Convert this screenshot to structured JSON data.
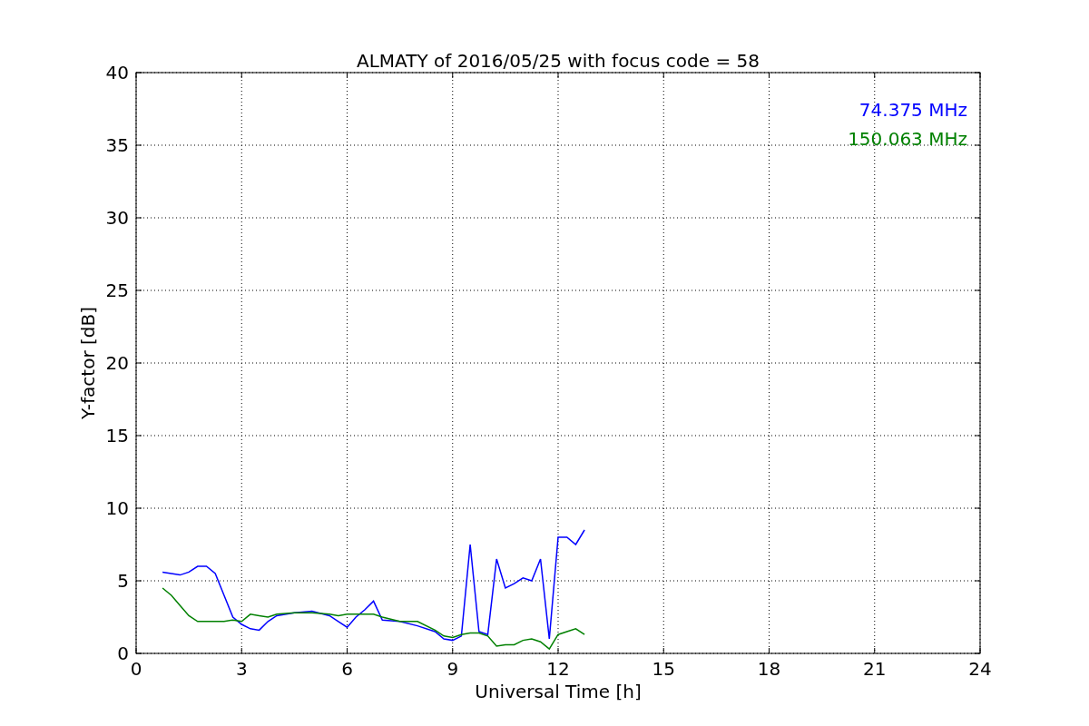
{
  "chart_data": {
    "type": "line",
    "title": "ALMATY of 2016/05/25 with focus code = 58",
    "xlabel": "Universal Time [h]",
    "ylabel": "Y-factor [dB]",
    "x": [
      0.75,
      1.0,
      1.25,
      1.5,
      1.75,
      2.0,
      2.25,
      2.5,
      2.75,
      3.0,
      3.25,
      3.5,
      3.75,
      4.0,
      4.5,
      5.0,
      5.5,
      5.75,
      6.0,
      6.25,
      6.5,
      6.75,
      7.0,
      7.5,
      8.0,
      8.5,
      8.75,
      9.0,
      9.25,
      9.5,
      9.75,
      10.0,
      10.25,
      10.5,
      10.75,
      11.0,
      11.25,
      11.5,
      11.75,
      12.0,
      12.25,
      12.5,
      12.75
    ],
    "series": [
      {
        "name": "74.375 MHz",
        "color": "#0000ff",
        "values": [
          5.6,
          5.5,
          5.4,
          5.6,
          6.0,
          6.0,
          5.5,
          4.0,
          2.5,
          2.0,
          1.7,
          1.6,
          2.2,
          2.6,
          2.8,
          2.9,
          2.6,
          2.2,
          1.8,
          2.5,
          3.0,
          3.6,
          2.3,
          2.2,
          1.9,
          1.5,
          1.0,
          0.9,
          1.2,
          7.5,
          1.5,
          1.3,
          6.5,
          4.5,
          4.8,
          5.2,
          5.0,
          6.5,
          1.0,
          8.0,
          8.0,
          7.5,
          8.5
        ]
      },
      {
        "name": "150.063 MHz",
        "color": "#008000",
        "values": [
          4.5,
          4.0,
          3.3,
          2.6,
          2.2,
          2.2,
          2.2,
          2.2,
          2.3,
          2.2,
          2.7,
          2.6,
          2.5,
          2.7,
          2.8,
          2.8,
          2.7,
          2.6,
          2.7,
          2.7,
          2.7,
          2.7,
          2.5,
          2.2,
          2.2,
          1.6,
          1.2,
          1.1,
          1.3,
          1.4,
          1.4,
          1.2,
          0.5,
          0.6,
          0.6,
          0.9,
          1.0,
          0.8,
          0.3,
          1.3,
          1.5,
          1.7,
          1.3
        ]
      }
    ],
    "grid": true,
    "xlim": [
      0,
      24
    ],
    "ylim": [
      0,
      40
    ],
    "xticks": [
      0,
      3,
      6,
      9,
      12,
      15,
      18,
      21,
      24
    ],
    "yticks": [
      0,
      5,
      10,
      15,
      20,
      25,
      30,
      35,
      40
    ]
  }
}
